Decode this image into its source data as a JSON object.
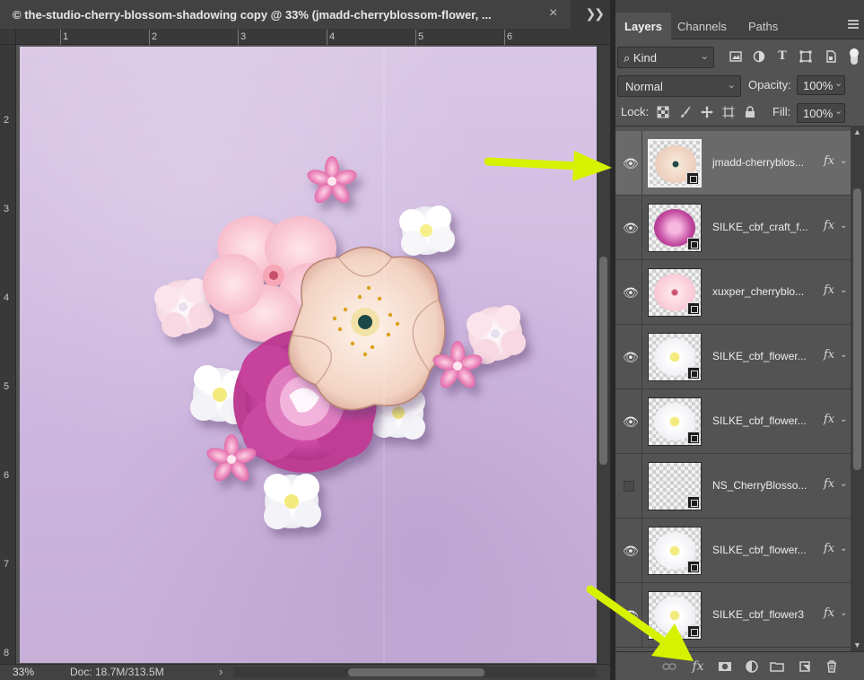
{
  "document": {
    "title": "© the-studio-cherry-blossom-shadowing copy @ 33% (jmadd-cherryblossom-flower, ...",
    "close_glyph": "×",
    "panel_toggle_glyph": "❯❯",
    "ruler_top": [
      "1",
      "2",
      "3",
      "4",
      "5",
      "6"
    ],
    "ruler_left": [
      "2",
      "3",
      "4",
      "5",
      "6",
      "7",
      "8"
    ]
  },
  "status": {
    "zoom": "33%",
    "doc_info": "Doc: 18.7M/313.5M",
    "arrow": "›"
  },
  "panel": {
    "tabs": [
      "Layers",
      "Channels",
      "Paths"
    ],
    "active_tab": "Layers",
    "filter": {
      "kind_label": "Kind",
      "kind_glyph": "⌕"
    },
    "blend_mode": "Normal",
    "opacity_label": "Opacity:",
    "opacity_value": "100%",
    "lock_label": "Lock:",
    "fill_label": "Fill:",
    "fill_value": "100%",
    "layers": [
      {
        "name": "jmadd-cherryblos...",
        "visible": true,
        "selected": true,
        "fx": "fx",
        "thumb_color": "#f2d7c8"
      },
      {
        "name": "SILKE_cbf_craft_f...",
        "visible": true,
        "selected": false,
        "fx": "fx",
        "thumb_color": "#c24aa0"
      },
      {
        "name": "xuxper_cherryblo...",
        "visible": true,
        "selected": false,
        "fx": "fx",
        "thumb_color": "#f6c6d6"
      },
      {
        "name": "SILKE_cbf_flower...",
        "visible": true,
        "selected": false,
        "fx": "fx",
        "thumb_color": "#fafaf0"
      },
      {
        "name": "SILKE_cbf_flower...",
        "visible": true,
        "selected": false,
        "fx": "fx",
        "thumb_color": "#fafaf0"
      },
      {
        "name": "NS_CherryBlosso...",
        "visible": false,
        "selected": false,
        "fx": "fx",
        "thumb_color": "#f2f2f2"
      },
      {
        "name": "SILKE_cbf_flower...",
        "visible": true,
        "selected": false,
        "fx": "fx",
        "thumb_color": "#fafaf0"
      },
      {
        "name": "SILKE_cbf_flower3",
        "visible": true,
        "selected": false,
        "fx": "fx",
        "thumb_color": "#fafaf0"
      }
    ],
    "footer_icons": [
      "link-icon",
      "fx-icon",
      "mask-icon",
      "adjustment-icon",
      "folder-icon",
      "new-layer-icon",
      "trash-icon"
    ],
    "footer_fx_label": "fx"
  },
  "colors": {
    "callout_arrow": "#d6f200",
    "canvas_purple": "#d3bfe2"
  }
}
